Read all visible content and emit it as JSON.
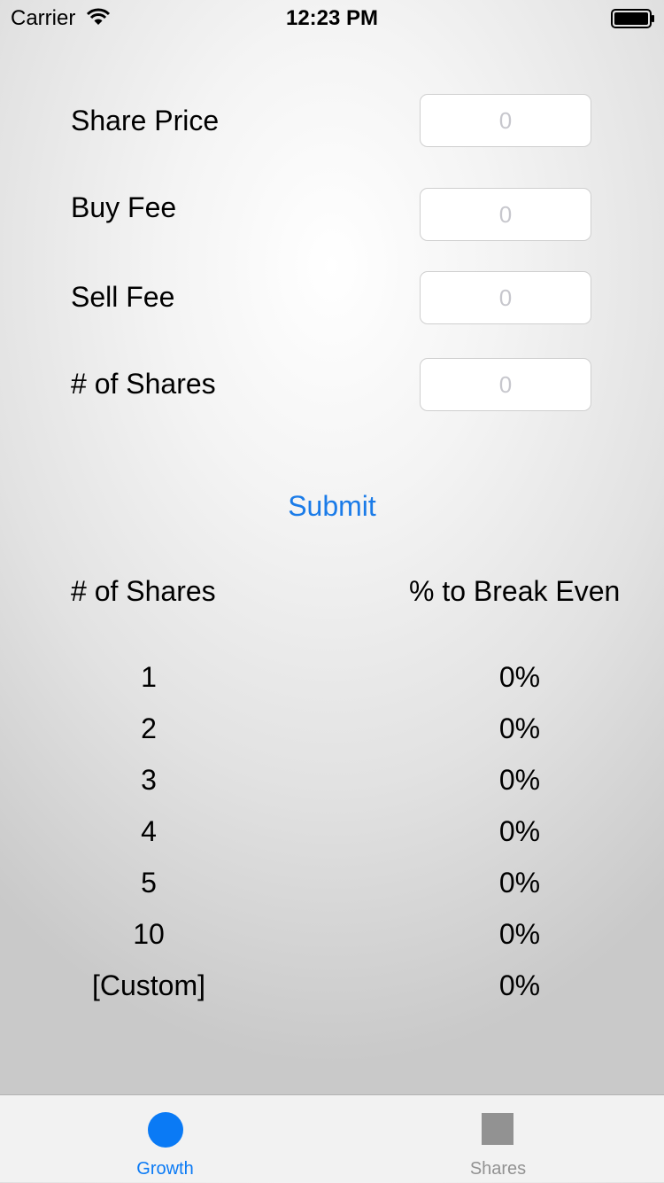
{
  "status_bar": {
    "carrier": "Carrier",
    "time": "12:23 PM",
    "wifi_icon": "wifi-icon",
    "battery_icon": "battery-icon"
  },
  "form": {
    "share_price": {
      "label": "Share Price",
      "value": "",
      "placeholder": "0"
    },
    "buy_fee": {
      "label": "Buy Fee",
      "value": "",
      "placeholder": "0"
    },
    "sell_fee": {
      "label": "Sell Fee",
      "value": "",
      "placeholder": "0"
    },
    "num_shares": {
      "label": "# of Shares",
      "value": "",
      "placeholder": "0"
    }
  },
  "submit_label": "Submit",
  "results": {
    "headers": {
      "shares": "# of Shares",
      "breakeven": "% to Break Even"
    },
    "rows": [
      {
        "shares": "1",
        "pct": "0%"
      },
      {
        "shares": "2",
        "pct": "0%"
      },
      {
        "shares": "3",
        "pct": "0%"
      },
      {
        "shares": "4",
        "pct": "0%"
      },
      {
        "shares": "5",
        "pct": "0%"
      },
      {
        "shares": "10",
        "pct": "0%"
      },
      {
        "shares": "[Custom]",
        "pct": "0%"
      }
    ]
  },
  "tabs": [
    {
      "label": "Growth",
      "icon": "circle-icon",
      "active": true
    },
    {
      "label": "Shares",
      "icon": "square-icon",
      "active": false
    }
  ],
  "colors": {
    "accent": "#0a7af5",
    "submit": "#1a7be8",
    "inactive_tab": "#929292"
  }
}
